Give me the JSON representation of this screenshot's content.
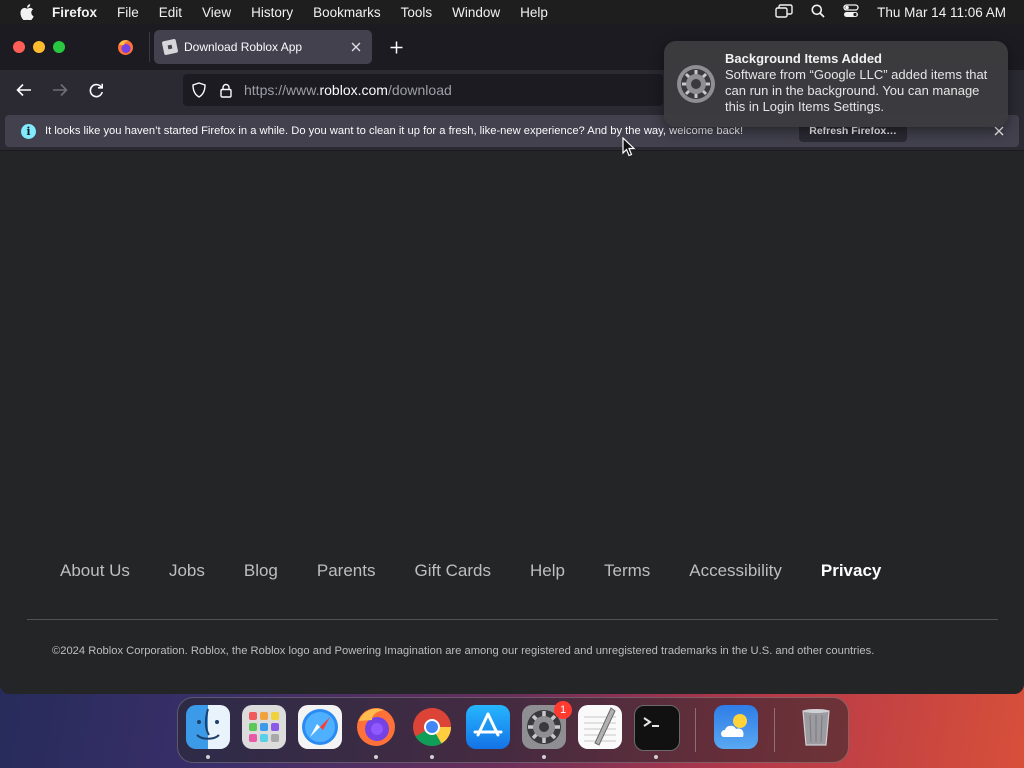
{
  "menubar": {
    "app": "Firefox",
    "items": [
      "File",
      "Edit",
      "View",
      "History",
      "Bookmarks",
      "Tools",
      "Window",
      "Help"
    ],
    "clock": "Thu Mar 14  11:06 AM"
  },
  "browser": {
    "tab_title": "Download Roblox App",
    "url_prefix": "https://www.",
    "url_domain": "roblox.com",
    "url_path": "/download"
  },
  "infobar": {
    "message": "It looks like you haven’t started Firefox in a while. Do you want to clean it up for a fresh, like-new experience? And by the way, welcome back!",
    "button": "Refresh Firefox…"
  },
  "notification": {
    "title": "Background Items Added",
    "body": "Software from “Google LLC” added items that can run in the background. You can manage this in Login Items Settings."
  },
  "footer": {
    "links": [
      "About Us",
      "Jobs",
      "Blog",
      "Parents",
      "Gift Cards",
      "Help",
      "Terms",
      "Accessibility",
      "Privacy"
    ],
    "copyright": "©2024 Roblox Corporation. Roblox, the Roblox logo and Powering Imagination are among our registered and unregistered trademarks in the U.S. and other countries."
  },
  "dock": {
    "apps": [
      "finder-icon",
      "launchpad-icon",
      "safari-icon",
      "firefox-icon",
      "chrome-icon",
      "app-store-icon",
      "system-settings-icon",
      "textedit-icon",
      "terminal-icon",
      "weather-icon",
      "trash-icon"
    ],
    "settings_badge": "1"
  }
}
